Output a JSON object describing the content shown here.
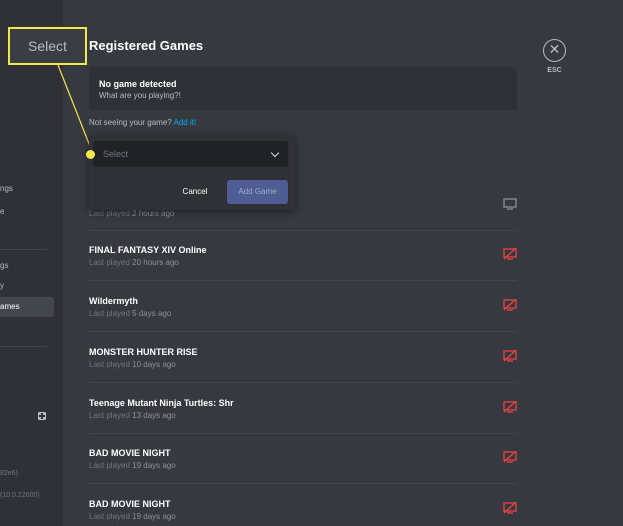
{
  "sidebar": {
    "items": [
      {
        "label": "ngs",
        "active": false
      },
      {
        "label": "e",
        "active": false
      },
      {
        "label": "gs",
        "active": false
      },
      {
        "label": "y",
        "active": false
      },
      {
        "label": "ames",
        "active": true
      }
    ],
    "footer": [
      "82e6)",
      "(10.0.22000)"
    ]
  },
  "callout": {
    "label": "Select"
  },
  "page": {
    "title": "Registered Games",
    "close_label": "ESC",
    "close_glyph": "✕"
  },
  "detection": {
    "title": "No game detected",
    "subtitle": "What are you playing?!"
  },
  "not_seeing": {
    "text": "Not seeing your game?",
    "link": "Add it!"
  },
  "add_popup": {
    "select_placeholder": "Select",
    "cancel_label": "Cancel",
    "add_label": "Add Game"
  },
  "games": [
    {
      "name": "",
      "last_played_prefix": "Last played",
      "last_played": "2 hours ago",
      "overlay": "monitor-icon",
      "overlay_color": "#8e9297"
    },
    {
      "name": "FINAL FANTASY XIV Online",
      "last_played_prefix": "Last played",
      "last_played": "20 hours ago",
      "overlay": "overlay-disabled-icon",
      "overlay_color": "#ed4245"
    },
    {
      "name": "Wildermyth",
      "last_played_prefix": "Last played",
      "last_played": "5 days ago",
      "overlay": "overlay-disabled-icon",
      "overlay_color": "#ed4245"
    },
    {
      "name": "MONSTER HUNTER RISE",
      "last_played_prefix": "Last played",
      "last_played": "10 days ago",
      "overlay": "overlay-disabled-icon",
      "overlay_color": "#ed4245"
    },
    {
      "name": "Teenage Mutant Ninja Turtles: Shr",
      "last_played_prefix": "Last played",
      "last_played": "13 days ago",
      "overlay": "overlay-disabled-icon",
      "overlay_color": "#ed4245"
    },
    {
      "name": "BAD MOVIE NIGHT",
      "last_played_prefix": "Last played",
      "last_played": "19 days ago",
      "overlay": "overlay-disabled-icon",
      "overlay_color": "#ed4245"
    },
    {
      "name": "BAD MOVIE NIGHT",
      "last_played_prefix": "Last played",
      "last_played": "19 days ago",
      "overlay": "overlay-disabled-icon",
      "overlay_color": "#ed4245"
    }
  ],
  "colors": {
    "accent": "#f4e74d",
    "link": "#00aff4",
    "danger": "#ed4245",
    "button": "#4e5d94"
  }
}
